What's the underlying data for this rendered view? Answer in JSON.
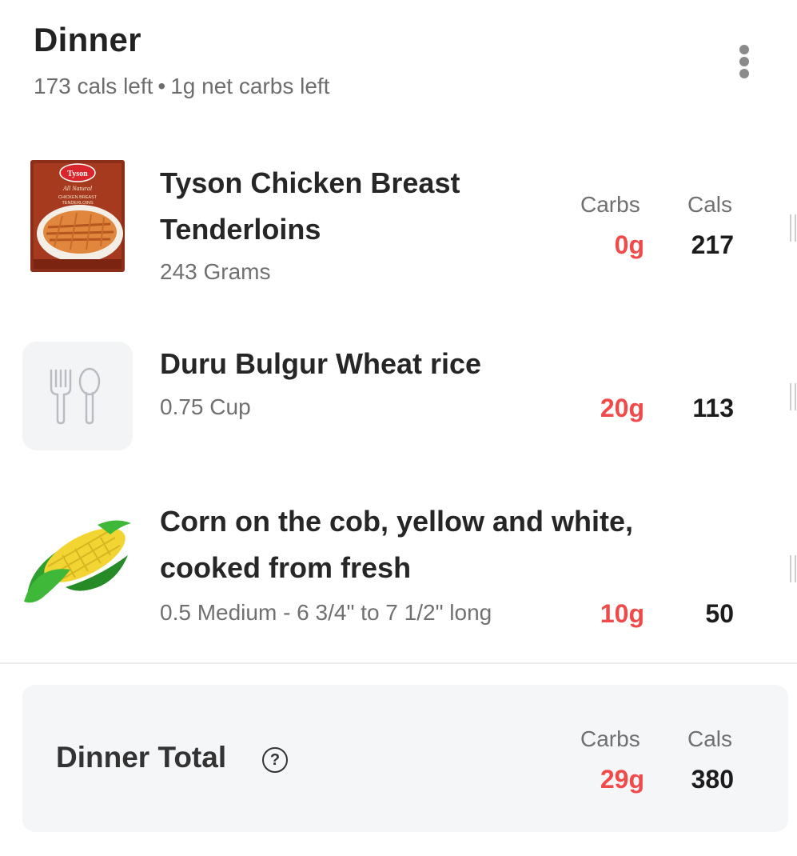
{
  "header": {
    "title": "Dinner",
    "cals_left": "173 cals left",
    "separator": "•",
    "carbs_left": "1g net carbs left",
    "menu_icon": "more-vertical-icon"
  },
  "column_labels": {
    "carbs": "Carbs",
    "cals": "Cals"
  },
  "items": [
    {
      "name_line1": "Tyson Chicken Breast",
      "name_line2": "Tenderloins",
      "serving": "243 Grams",
      "carbs": "0g",
      "cals": "217",
      "thumbnail": "product-package-image",
      "package_text": {
        "brand": "Tyson",
        "tagline": "All Natural",
        "product": "CHICKEN BREAST",
        "variant": "TENDERLOINS"
      }
    },
    {
      "name_line1": "Duru Bulgur Wheat rice",
      "serving": "0.75 Cup",
      "carbs": "20g",
      "cals": "113",
      "thumbnail": "fork-spoon-icon"
    },
    {
      "name_line1": "Corn on the cob, yellow and white,",
      "name_line2": "cooked from fresh",
      "serving": "0.5 Medium - 6 3/4\" to 7 1/2\" long",
      "carbs": "10g",
      "cals": "50",
      "thumbnail": "corn-icon"
    }
  ],
  "total": {
    "label": "Dinner Total",
    "help_icon": "question-circle-icon",
    "help_glyph": "?",
    "carbs_label": "Carbs",
    "cals_label": "Cals",
    "carbs": "29g",
    "cals": "380"
  },
  "colors": {
    "carbs_accent": "#f04a4a",
    "divider": "#ececec",
    "total_bg": "#f5f6f8"
  }
}
